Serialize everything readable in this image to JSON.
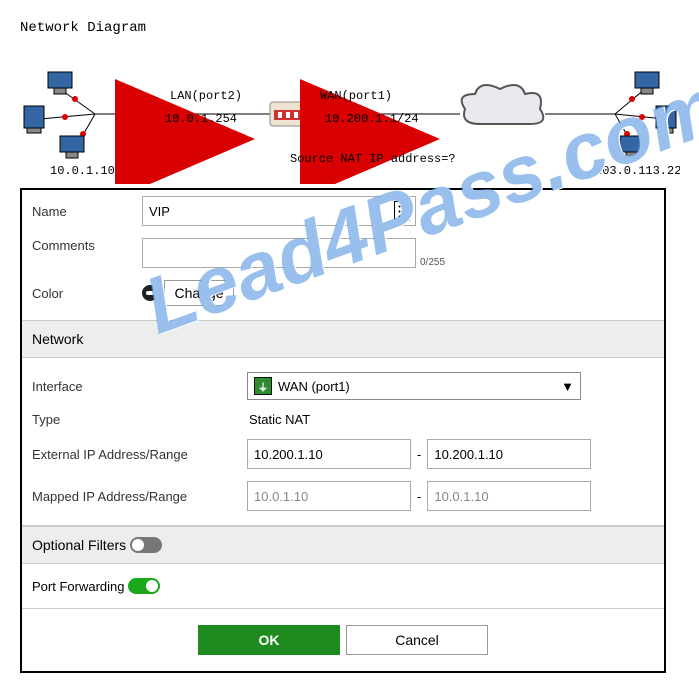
{
  "title": "Network Diagram",
  "diagram": {
    "lan_label": "LAN(port2)",
    "lan_ip": "10.0.1.254",
    "wan_label": "WAN(port1)",
    "wan_ip": "10.200.1.1/24",
    "src_nat_q": "Source NAT IP address=?",
    "left_host": "10.0.1.10/24",
    "right_host": "203.0.113.22"
  },
  "form": {
    "name_label": "Name",
    "name_value": "VIP",
    "comments_label": "Comments",
    "comments_value": "",
    "comments_count": "0/255",
    "color_label": "Color",
    "change_btn": "Change",
    "network_header": "Network",
    "interface_label": "Interface",
    "interface_value": "WAN (port1)",
    "type_label": "Type",
    "type_value": "Static NAT",
    "ext_ip_label": "External IP Address/Range",
    "ext_ip_from": "10.200.1.10",
    "ext_ip_to": "10.200.1.10",
    "map_ip_label": "Mapped IP Address/Range",
    "map_ip_from": "10.0.1.10",
    "map_ip_to": "10.0.1.10",
    "opt_filters_label": "Optional Filters",
    "port_fwd_label": "Port Forwarding",
    "ok": "OK",
    "cancel": "Cancel"
  },
  "watermark": "Lead4Pass.com"
}
